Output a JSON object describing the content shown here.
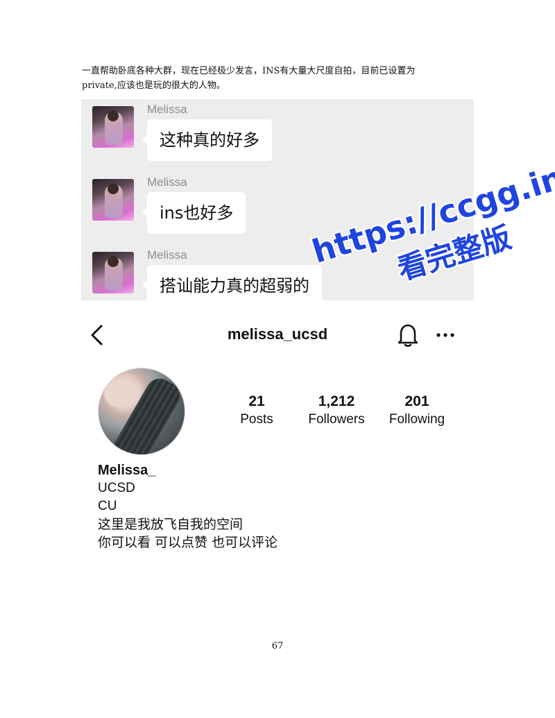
{
  "intro_text": {
    "line1": "一直帮助卧底各种大群，现在已经极少发言，INS有大量大尺度自拍，目前已设置为",
    "line2": "private,应该也是玩的很大的人物。"
  },
  "chat": {
    "messages": [
      {
        "sender": "Melissa",
        "text": "这种真的好多"
      },
      {
        "sender": "Melissa",
        "text": "ins也好多"
      },
      {
        "sender": "Melissa",
        "text": "搭讪能力真的超弱的"
      }
    ]
  },
  "watermark": {
    "line1": "https://ccgg.ink",
    "line2": "看完整版",
    "color": "#1f44e0"
  },
  "profile": {
    "back_icon": "chevron-left-icon",
    "username": "melissa_ucsd",
    "bell_icon": "bell-icon",
    "more_icon": "more-dots-icon",
    "stats": {
      "posts": {
        "value": "21",
        "label": "Posts"
      },
      "followers": {
        "value": "1,212",
        "label": "Followers"
      },
      "following": {
        "value": "201",
        "label": "Following"
      }
    },
    "display_name": "Melissa_",
    "bio": [
      "UCSD",
      "CU",
      "这里是我放飞自我的空间",
      "你可以看 可以点赞 也可以评论"
    ]
  },
  "page_number": "67"
}
